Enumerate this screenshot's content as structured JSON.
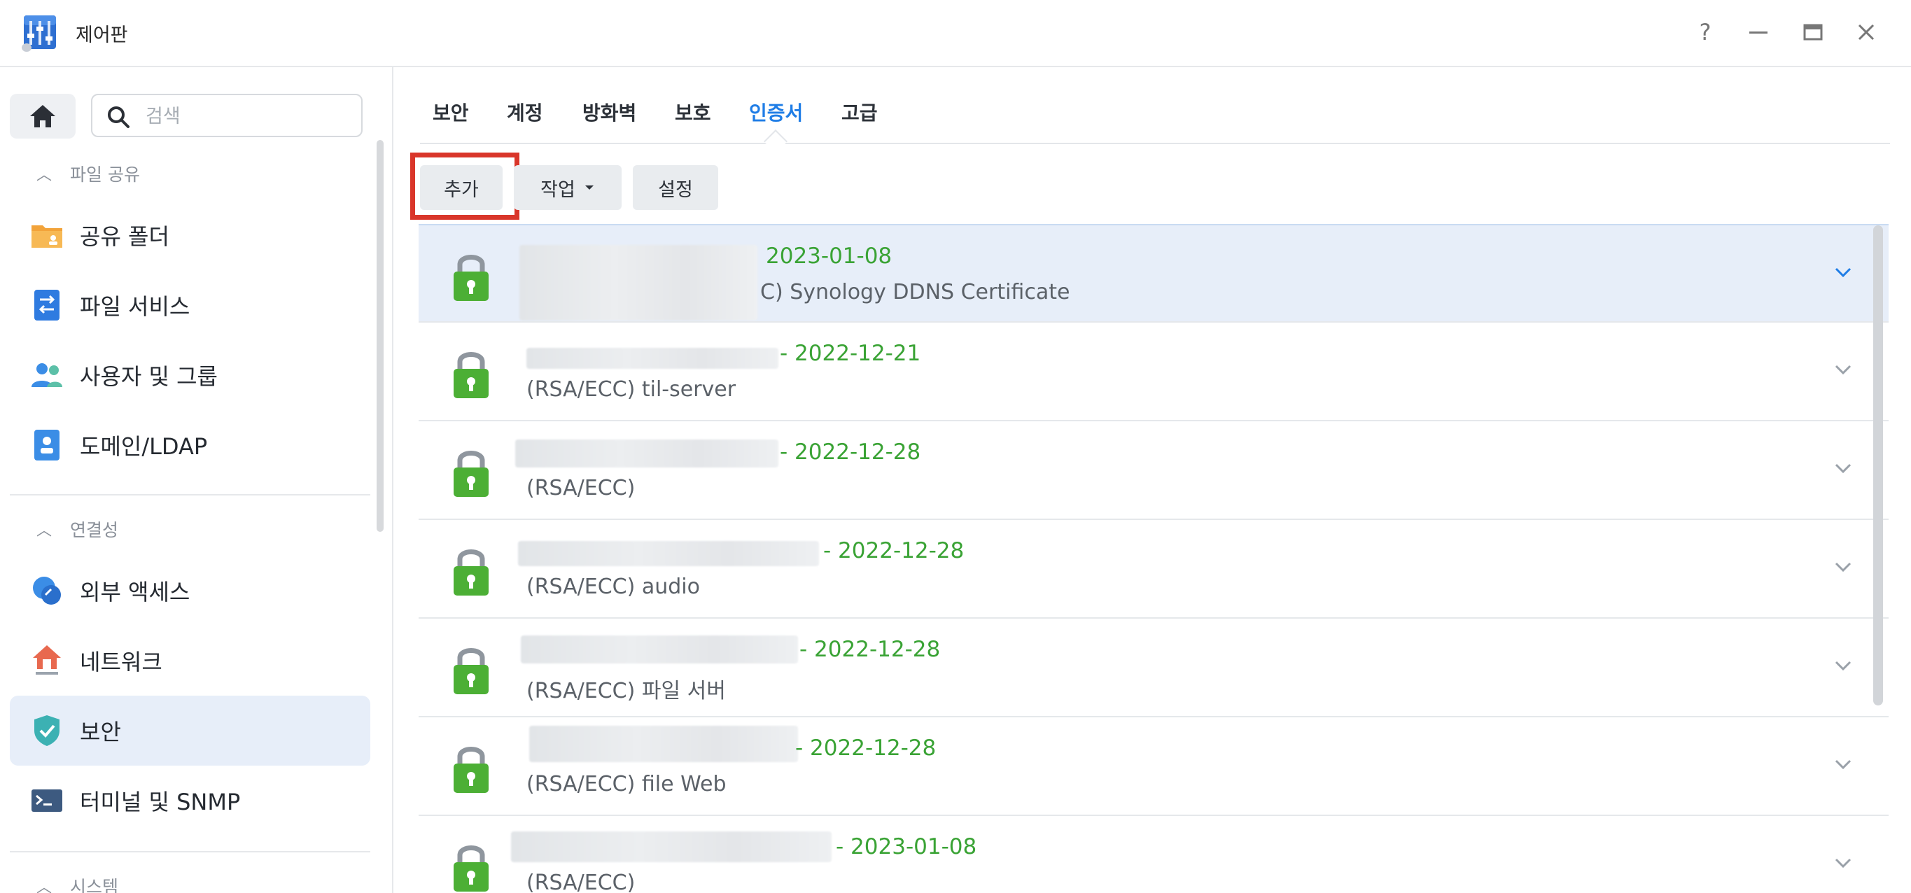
{
  "window": {
    "title": "제어판",
    "controls": [
      "?",
      "—",
      "□",
      "✕"
    ]
  },
  "sidebar": {
    "search_placeholder": "검색",
    "sections": [
      {
        "label": "파일 공유",
        "items": [
          "공유 폴더",
          "파일 서비스",
          "사용자 및 그룹",
          "도메인/LDAP"
        ]
      },
      {
        "label": "연결성",
        "items": [
          "외부 액세스",
          "네트워크",
          "보안",
          "터미널 및 SNMP"
        ]
      },
      {
        "label": "시스템",
        "items": []
      }
    ],
    "active_item": "보안"
  },
  "tabs": [
    "보안",
    "계정",
    "방화벽",
    "보호",
    "인증서",
    "고급"
  ],
  "active_tab": "인증서",
  "toolbar": {
    "add": "추가",
    "action": "작업",
    "settings": "설정"
  },
  "certificates": [
    {
      "date": "2023-01-08",
      "desc": "C) Synology DDNS Certificate",
      "selected": true
    },
    {
      "date": "2022-12-21",
      "desc": "(RSA/ECC) til-server"
    },
    {
      "date": "2022-12-28",
      "desc": "(RSA/ECC)"
    },
    {
      "date": "2022-12-28",
      "desc": "(RSA/ECC) audio"
    },
    {
      "date": "2022-12-28",
      "desc": "(RSA/ECC) 파일 서버"
    },
    {
      "date": "2022-12-28",
      "desc": "(RSA/ECC) file Web"
    },
    {
      "date": "2023-01-08",
      "desc": "(RSA/ECC)"
    }
  ],
  "colors": {
    "accent": "#1f7de6",
    "date_green": "#3aa335",
    "highlight_red": "#d9362a",
    "lock_green": "#4caf35"
  }
}
